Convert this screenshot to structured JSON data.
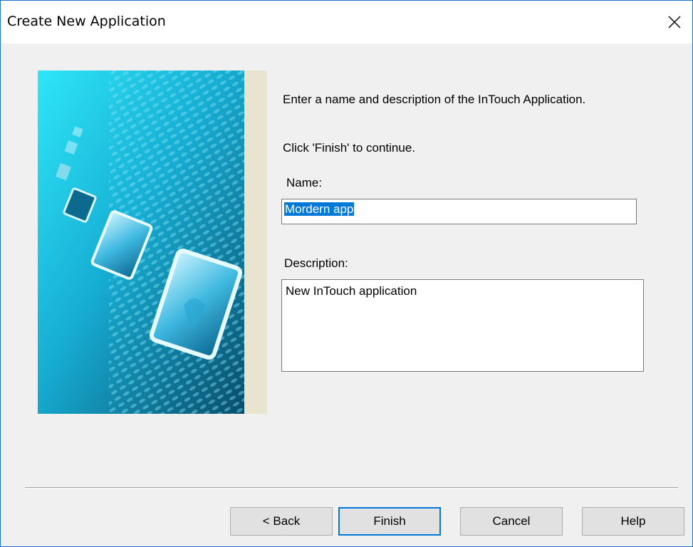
{
  "window": {
    "title": "Create New Application",
    "close_icon": "close-icon",
    "border_color": "#1a73c9"
  },
  "instructions": {
    "line1": "Enter a name and description of the InTouch Application.",
    "line2": "Click 'Finish' to continue."
  },
  "name_field": {
    "label": "Name:",
    "value": "Mordern app",
    "selected": true
  },
  "description_field": {
    "label": "Description:",
    "value": "New InTouch application"
  },
  "buttons": {
    "back": "< Back",
    "finish": "Finish",
    "cancel": "Cancel",
    "help": "Help"
  },
  "colors": {
    "accent": "#0078d7",
    "banner_cyan": "#19c8e6",
    "banner_dark": "#0d4f70"
  }
}
